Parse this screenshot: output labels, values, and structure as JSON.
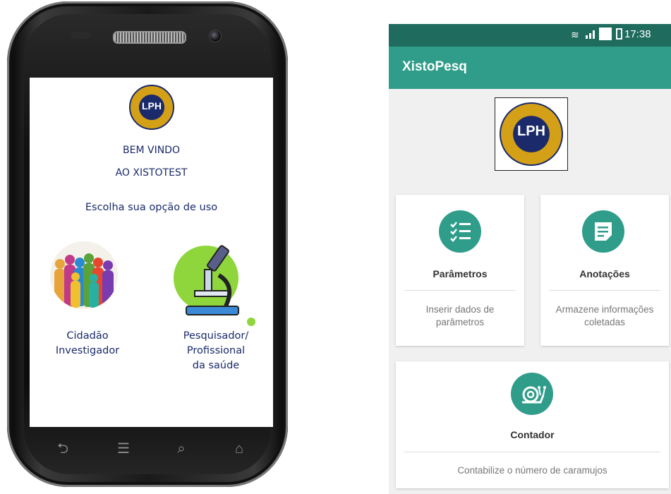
{
  "left_phone": {
    "logo_text": "LPH",
    "welcome_line1": "BEM VINDO",
    "welcome_line2": "AO XISTOTEST",
    "choose_text": "Escolha sua opção de uso",
    "option_citizen_line1": "Cidadão",
    "option_citizen_line2": "Investigador",
    "option_researcher_line1": "Pesquisador/",
    "option_researcher_line2": "Profissional",
    "option_researcher_line3": "da saúde"
  },
  "status_bar": {
    "time": "17:38"
  },
  "app": {
    "title": "XistoPesq",
    "logo_text": "LPH",
    "cards": {
      "parametros": {
        "title": "Parâmetros",
        "desc_line1": "Inserir dados de",
        "desc_line2": "parâmetros"
      },
      "anotacoes": {
        "title": "Anotações",
        "desc_line1": "Armazene informações",
        "desc_line2": "coletadas"
      },
      "contador": {
        "title": "Contador",
        "desc": "Contabilize o número de caramujos"
      }
    }
  },
  "colors": {
    "primary": "#2f9d8a",
    "primary_dark": "#1f6b5e",
    "welcome_text": "#1a2a6a",
    "logo_gold": "#d4a017"
  },
  "icons": [
    "checklist-icon",
    "note-icon",
    "snail-icon",
    "wifi-icon",
    "signal-icon",
    "battery-icon",
    "back-icon",
    "menu-icon",
    "search-icon",
    "home-icon",
    "microscope-icon"
  ]
}
